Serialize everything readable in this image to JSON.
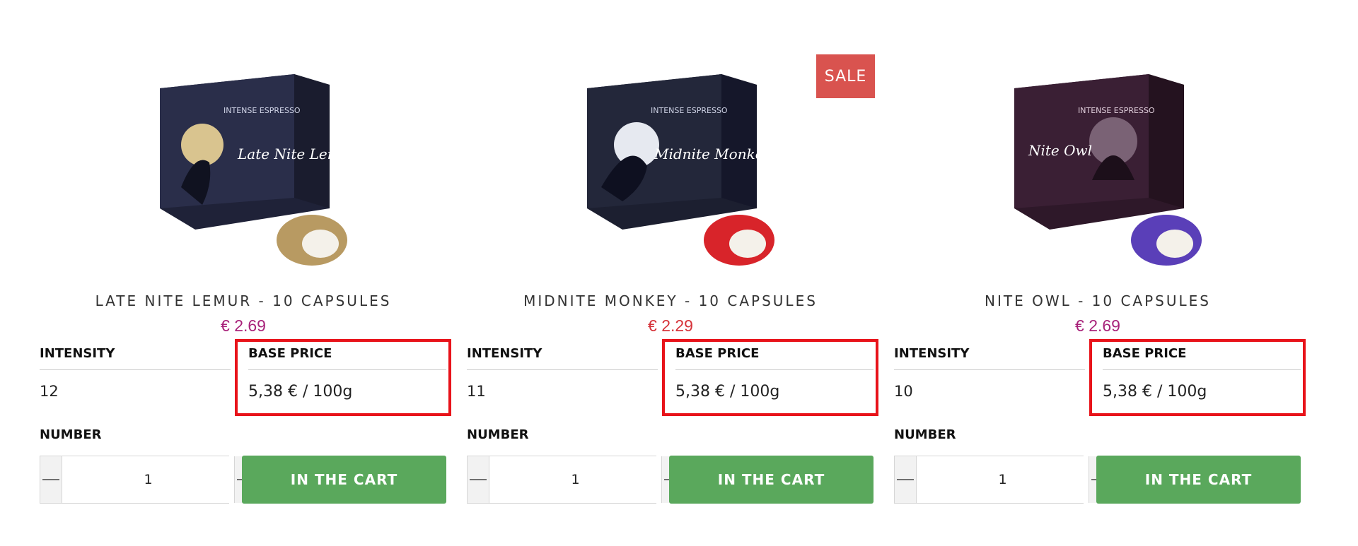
{
  "products": [
    {
      "name": "LATE NITE LEMUR - 10 CAPSULES",
      "price": "€ 2.69",
      "price_color": "#a8227a",
      "intensity_label": "INTENSITY",
      "intensity_value": "12",
      "base_price_label": "BASE PRICE",
      "base_price_value": "5,38 € / 100g",
      "number_label": "NUMBER",
      "quantity": "1",
      "cart_label": "IN THE CART",
      "sale": false,
      "box_color": "#2a2e4a",
      "capsule_color": "#b89a62",
      "box_text": "INTENSE ESPRESSO",
      "box_script": "Late Nite Lemur"
    },
    {
      "name": "MIDNITE MONKEY - 10 CAPSULES",
      "price": "€ 2.29",
      "price_color": "#d6333a",
      "intensity_label": "INTENSITY",
      "intensity_value": "11",
      "base_price_label": "BASE PRICE",
      "base_price_value": "5,38 € / 100g",
      "number_label": "NUMBER",
      "quantity": "1",
      "cart_label": "IN THE CART",
      "sale": true,
      "sale_label": "SALE",
      "box_color": "#23273a",
      "capsule_color": "#d8242a",
      "box_text": "INTENSE ESPRESSO",
      "box_script": "Midnite Monkey"
    },
    {
      "name": "NITE OWL - 10 CAPSULES",
      "price": "€ 2.69",
      "price_color": "#a8227a",
      "intensity_label": "INTENSITY",
      "intensity_value": "10",
      "base_price_label": "BASE PRICE",
      "base_price_value": "5,38 € / 100g",
      "number_label": "NUMBER",
      "quantity": "1",
      "cart_label": "IN THE CART",
      "sale": false,
      "box_color": "#3a1f34",
      "capsule_color": "#5a3fb8",
      "box_text": "INTENSE ESPRESSO",
      "box_script": "Nite Owl"
    }
  ],
  "colors": {
    "cart_button": "#5aa85c",
    "sale_badge": "#d9534f",
    "highlight_box": "#e8131a"
  },
  "icons": {
    "decrement": "minus-icon",
    "increment": "plus-icon"
  }
}
